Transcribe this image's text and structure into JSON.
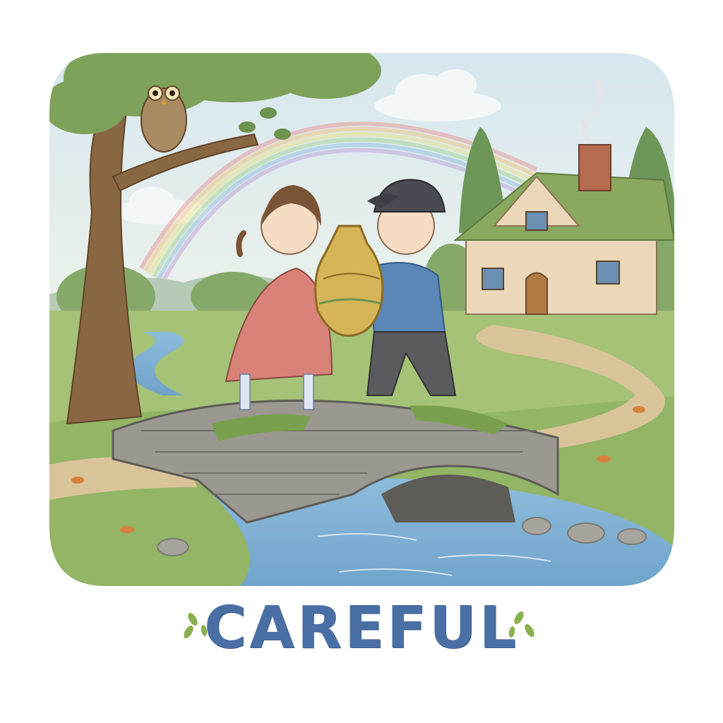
{
  "caption": {
    "text": "CAREFUL"
  },
  "colors": {
    "sky": "#dfeaf0",
    "grass": "#9cbf6b",
    "river": "#7fb0d4",
    "caption": "#4a6fa5",
    "leaf_sprig": "#8ab04f"
  },
  "illustration": {
    "subjects": [
      "owl-on-branch",
      "girl-in-pink-dress",
      "boy-in-blue-sweater",
      "golden-vase",
      "stone-bridge",
      "cottage",
      "rainbow",
      "stream"
    ]
  }
}
